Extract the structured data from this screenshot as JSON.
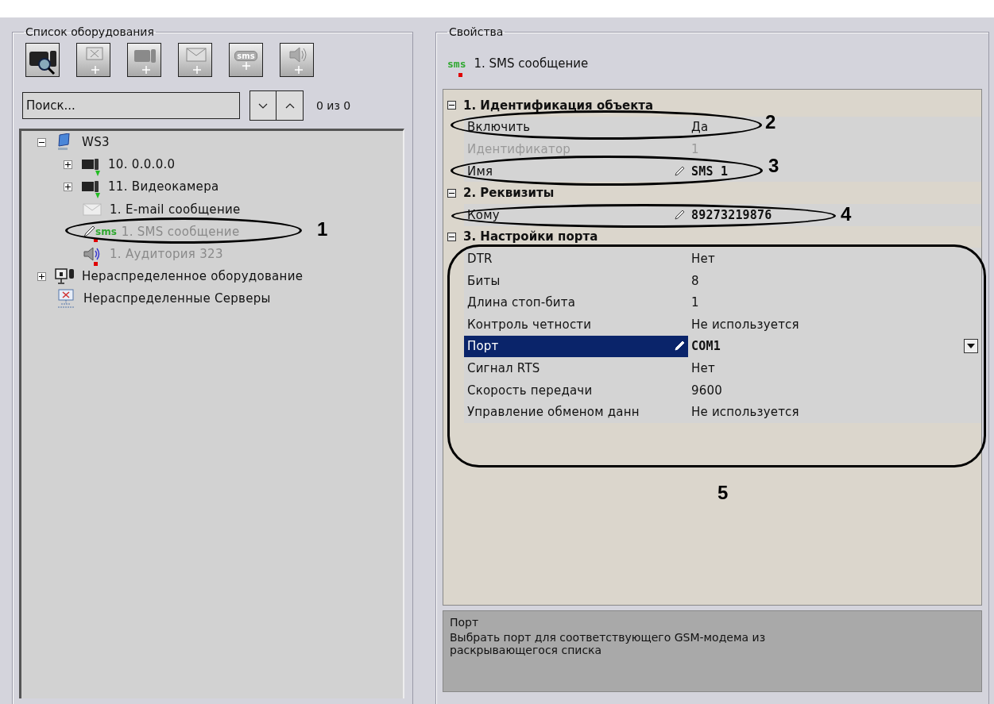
{
  "equipment_panel": {
    "title": "Список оборудования",
    "toolbar": [
      {
        "disabled": false
      },
      {
        "disabled": true
      },
      {
        "disabled": true
      },
      {
        "disabled": true
      },
      {
        "disabled": true,
        "icon_text": "sms"
      },
      {
        "disabled": true
      }
    ],
    "search": {
      "placeholder": "Поиск...",
      "count": "0 из 0"
    },
    "tree": [
      {
        "label": "WS3",
        "kind": "computer",
        "expanded": true,
        "disabled": false,
        "children": [
          {
            "label": "10. 0.0.0.0",
            "kind": "camera",
            "expanded": false,
            "disabled": false,
            "color": "#22bb22"
          },
          {
            "label": "11. Видеокамера",
            "kind": "camera",
            "expanded": false,
            "disabled": false,
            "color": "#22bb22"
          },
          {
            "label": "1. E-mail сообщение",
            "kind": "mail",
            "disabled": false
          },
          {
            "label": "1. SMS сообщение",
            "kind": "sms",
            "icon_text": "sms",
            "disabled": true,
            "color": "#e00000"
          },
          {
            "label": "1. Аудитория 323",
            "kind": "speaker",
            "disabled": true,
            "color": "#e00000"
          }
        ]
      },
      {
        "label": "Нераспределенное оборудование",
        "kind": "equipment",
        "expanded": false,
        "disabled": false
      },
      {
        "label": "Нераспределенные Серверы",
        "kind": "server",
        "disabled": false
      }
    ]
  },
  "properties_panel": {
    "title": "Свойства",
    "object": {
      "icon_text": "sms",
      "title": "1. SMS сообщение",
      "color": "#e00000"
    },
    "sections": [
      {
        "title": "1. Идентификация объекта",
        "expanded": true,
        "rows": [
          {
            "name": "Включить",
            "value": "Да",
            "disabled": false,
            "modified": false,
            "selected": false
          },
          {
            "name": "Идентификатор",
            "value": "1",
            "disabled": true,
            "modified": false,
            "selected": false
          },
          {
            "name": "Имя",
            "value": "SMS 1",
            "disabled": false,
            "modified": true,
            "selected": false
          }
        ]
      },
      {
        "title": "2. Реквизиты",
        "expanded": true,
        "rows": [
          {
            "name": "Кому",
            "value": "89273219876",
            "disabled": false,
            "modified": true,
            "selected": false
          }
        ]
      },
      {
        "title": "3. Настройки порта",
        "expanded": true,
        "rows": [
          {
            "name": "DTR",
            "value": "Нет",
            "disabled": false,
            "modified": false,
            "selected": false
          },
          {
            "name": "Биты",
            "value": "8",
            "disabled": false,
            "modified": false,
            "selected": false
          },
          {
            "name": "Длина стоп-бита",
            "value": "1",
            "disabled": false,
            "modified": false,
            "selected": false
          },
          {
            "name": "Контроль четности",
            "value": "Не используется",
            "disabled": false,
            "modified": false,
            "selected": false
          },
          {
            "name": "Порт",
            "value": "COM1",
            "disabled": false,
            "modified": true,
            "selected": true,
            "dropdown": true
          },
          {
            "name": "Сигнал RTS",
            "value": "Нет",
            "disabled": false,
            "modified": false,
            "selected": false
          },
          {
            "name": "Скорость передачи",
            "value": "9600",
            "disabled": false,
            "modified": false,
            "selected": false
          },
          {
            "name": "Управление обменом данн",
            "value": "Не используется",
            "disabled": false,
            "modified": false,
            "selected": false
          }
        ]
      }
    ],
    "description": {
      "title": "Порт",
      "text": "Выбрать порт для соответствующего GSM-модема из раскрывающегося списка"
    }
  },
  "callouts": [
    {
      "label": "1"
    },
    {
      "label": "2"
    },
    {
      "label": "3"
    },
    {
      "label": "4"
    },
    {
      "label": "5"
    }
  ]
}
